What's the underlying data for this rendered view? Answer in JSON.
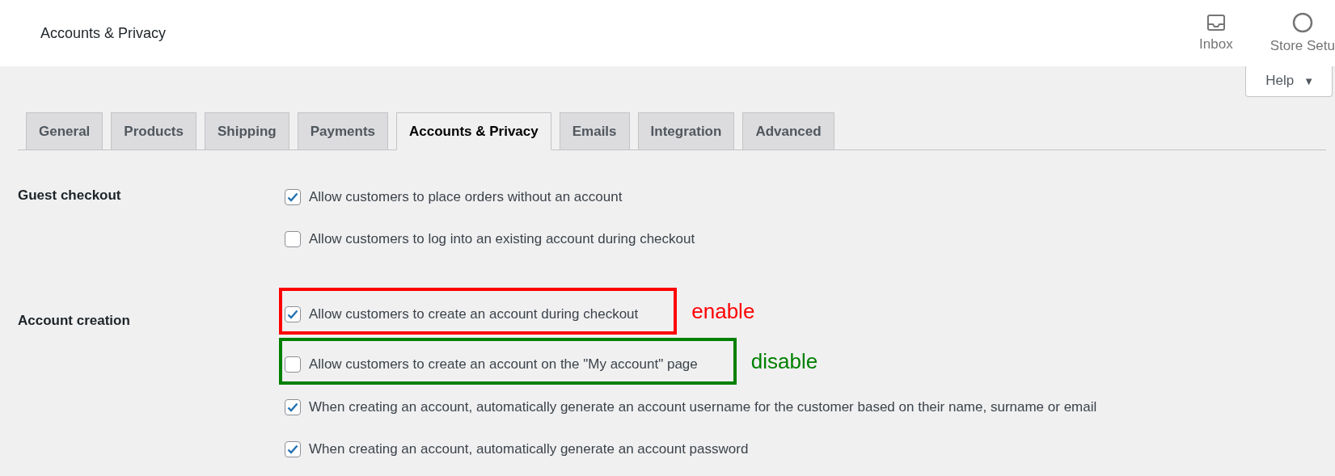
{
  "header": {
    "title": "Accounts & Privacy",
    "actions": [
      {
        "label": "Inbox",
        "kind": "inbox"
      },
      {
        "label": "Store Setu",
        "kind": "setup"
      }
    ]
  },
  "help": {
    "label": "Help",
    "icon": "▼"
  },
  "tabs": [
    {
      "label": "General",
      "selected": false
    },
    {
      "label": "Products",
      "selected": false
    },
    {
      "label": "Shipping",
      "selected": false
    },
    {
      "label": "Payments",
      "selected": false
    },
    {
      "label": "Accounts & Privacy",
      "selected": true
    },
    {
      "label": "Emails",
      "selected": false
    },
    {
      "label": "Integration",
      "selected": false
    },
    {
      "label": "Advanced",
      "selected": false
    }
  ],
  "sections": [
    {
      "label": "Guest checkout",
      "options": [
        {
          "label": "Allow customers to place orders without an account",
          "checked": true
        },
        {
          "label": "Allow customers to log into an existing account during checkout",
          "checked": false
        }
      ]
    },
    {
      "label": "Account creation",
      "options": [
        {
          "label": "Allow customers to create an account during checkout",
          "checked": true,
          "annotation": {
            "label": "enable",
            "color": "#ff0000"
          }
        },
        {
          "label": "Allow customers to create an account on the \"My account\" page",
          "checked": false,
          "annotation": {
            "label": "disable",
            "color": "#008000"
          }
        },
        {
          "label": "When creating an account, automatically generate an account username for the customer based on their name, surname or email",
          "checked": true
        },
        {
          "label": "When creating an account, automatically generate an account password",
          "checked": true
        }
      ]
    }
  ]
}
